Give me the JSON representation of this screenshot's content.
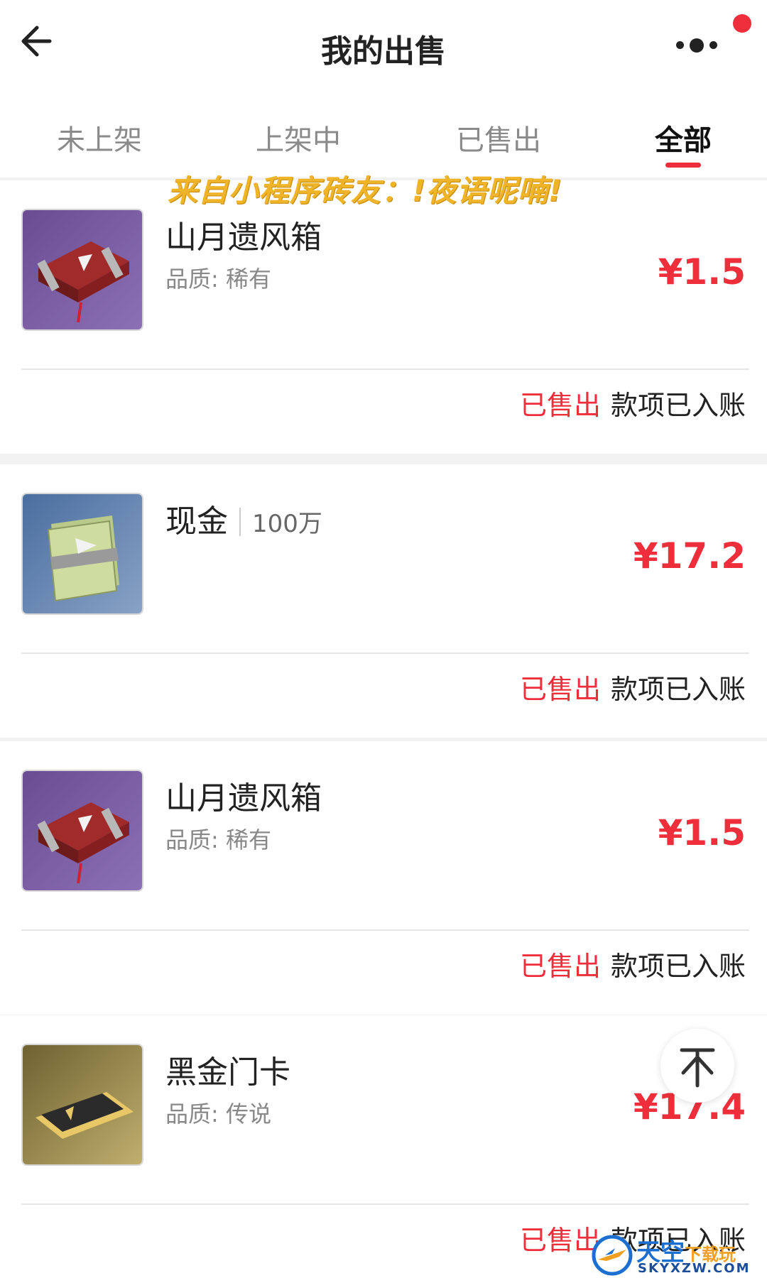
{
  "header": {
    "title": "我的出售"
  },
  "tabs": [
    {
      "label": "未上架",
      "active": false
    },
    {
      "label": "上架中",
      "active": false
    },
    {
      "label": "已售出",
      "active": false
    },
    {
      "label": "全部",
      "active": true
    }
  ],
  "watermark": "来自小程序砖友：!夜语呢喃!",
  "orders": [
    {
      "name": "山月遗风箱",
      "quality": "品质: 稀有",
      "price": "¥1.5",
      "status_sold": "已售出",
      "status_paid": "款项已入账"
    },
    {
      "name": "现金",
      "amount": "100万",
      "price": "¥17.2",
      "status_sold": "已售出",
      "status_paid": "款项已入账"
    },
    {
      "name": "山月遗风箱",
      "quality": "品质: 稀有",
      "price": "¥1.5",
      "status_sold": "已售出",
      "status_paid": "款项已入账"
    },
    {
      "name": "黑金门卡",
      "quality": "品质: 传说",
      "price": "¥17.4",
      "status_sold": "已售出",
      "status_paid": "款项已入账"
    }
  ],
  "site_logo": {
    "cn_main": "天空",
    "cn_sub": "下载玩",
    "en": "SKYXZW.COM"
  },
  "colors": {
    "accent": "#ee2f3b",
    "watermark": "#f0b428",
    "logo_blue": "#1b6fd0"
  }
}
